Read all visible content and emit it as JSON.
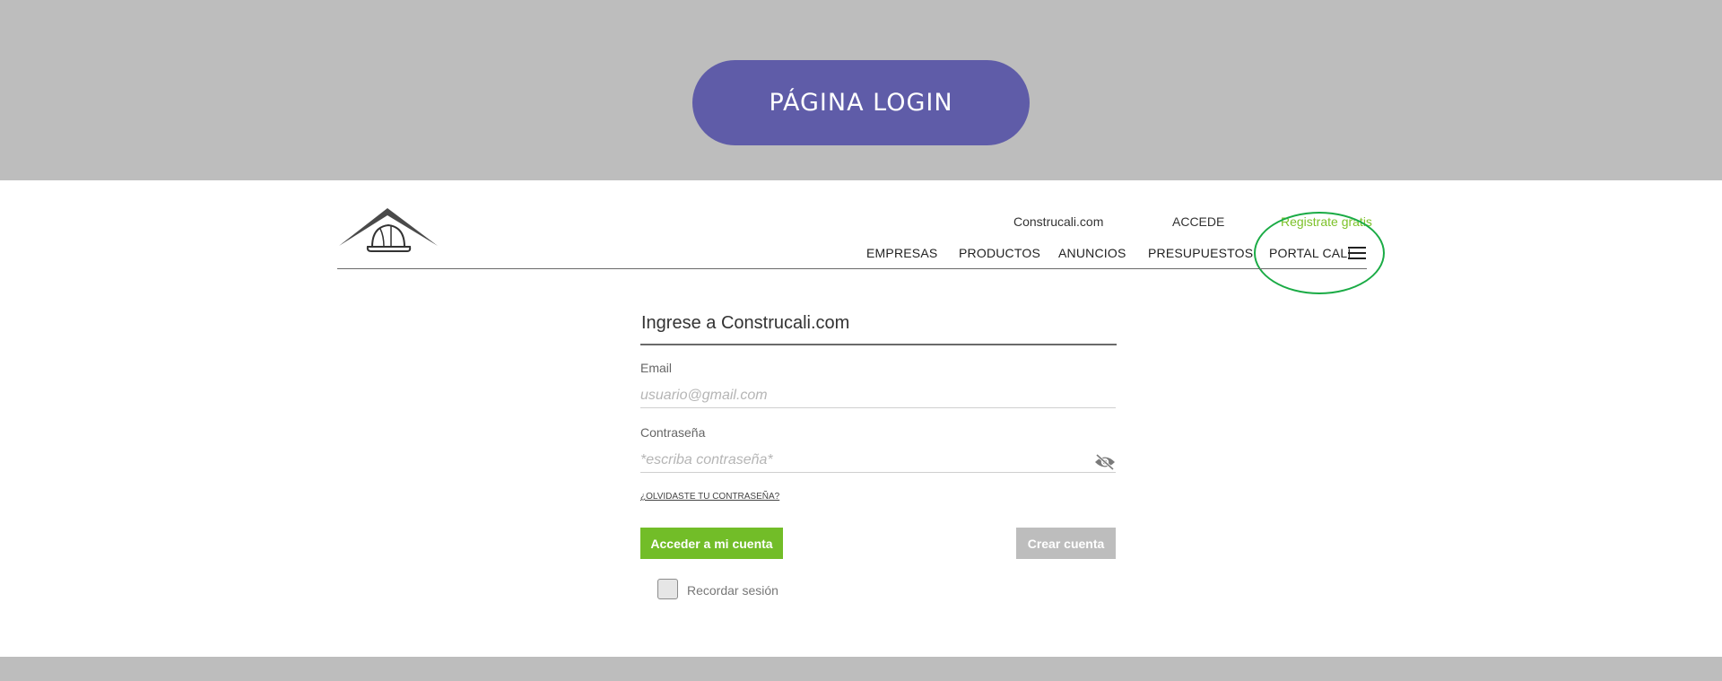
{
  "banner": {
    "title": "PÁGINA LOGIN"
  },
  "header": {
    "top_links": {
      "site": "Construcali.com",
      "login": "ACCEDE",
      "register": "Registrate gratis"
    },
    "main_nav": [
      "EMPRESAS",
      "PRODUCTOS",
      "ANUNCIOS",
      "PRESUPUESTOS",
      "PORTAL CALI"
    ]
  },
  "form": {
    "title": "Ingrese a Construcali.com",
    "email": {
      "label": "Email",
      "placeholder": "usuario@gmail.com",
      "value": ""
    },
    "password": {
      "label": "Contraseña",
      "placeholder": "*escriba contraseña*",
      "value": ""
    },
    "forgot_label": "¿OLVIDASTE TU CONTRASEÑA?",
    "submit_label": "Acceder a mi cuenta",
    "create_label": "Crear cuenta",
    "remember_label": "Recordar sesión",
    "remember_checked": false
  },
  "colors": {
    "banner_pill": "#5f5ca8",
    "accent_green": "#72bd28",
    "register_link": "#7dc22a",
    "highlight_ring": "#1aab45",
    "secondary_button": "#bdbdbd",
    "background": "#bdbdbd"
  },
  "icons": {
    "logo": "roof-helmet-logo",
    "menu": "hamburger-icon",
    "password_toggle": "eye-slash-icon"
  }
}
